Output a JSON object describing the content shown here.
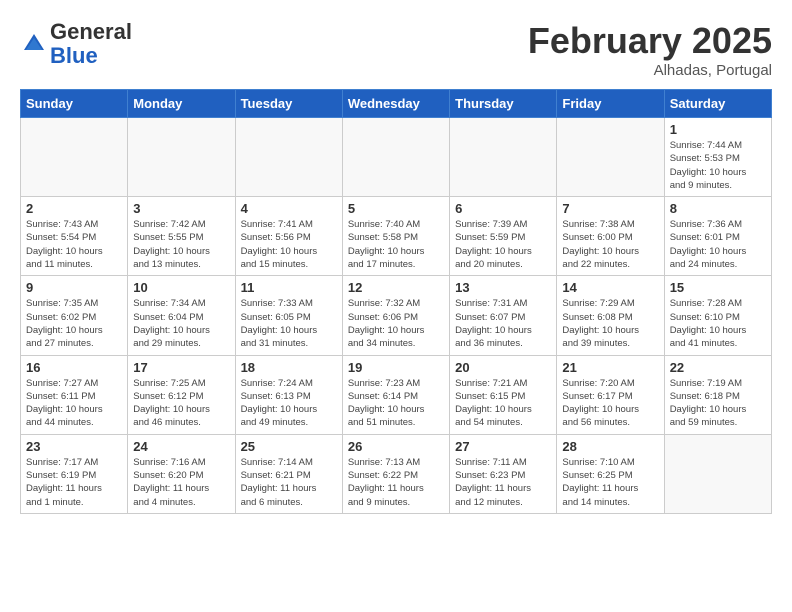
{
  "header": {
    "logo_general": "General",
    "logo_blue": "Blue",
    "month_year": "February 2025",
    "location": "Alhadas, Portugal"
  },
  "weekdays": [
    "Sunday",
    "Monday",
    "Tuesday",
    "Wednesday",
    "Thursday",
    "Friday",
    "Saturday"
  ],
  "weeks": [
    [
      {
        "day": "",
        "info": ""
      },
      {
        "day": "",
        "info": ""
      },
      {
        "day": "",
        "info": ""
      },
      {
        "day": "",
        "info": ""
      },
      {
        "day": "",
        "info": ""
      },
      {
        "day": "",
        "info": ""
      },
      {
        "day": "1",
        "info": "Sunrise: 7:44 AM\nSunset: 5:53 PM\nDaylight: 10 hours\nand 9 minutes."
      }
    ],
    [
      {
        "day": "2",
        "info": "Sunrise: 7:43 AM\nSunset: 5:54 PM\nDaylight: 10 hours\nand 11 minutes."
      },
      {
        "day": "3",
        "info": "Sunrise: 7:42 AM\nSunset: 5:55 PM\nDaylight: 10 hours\nand 13 minutes."
      },
      {
        "day": "4",
        "info": "Sunrise: 7:41 AM\nSunset: 5:56 PM\nDaylight: 10 hours\nand 15 minutes."
      },
      {
        "day": "5",
        "info": "Sunrise: 7:40 AM\nSunset: 5:58 PM\nDaylight: 10 hours\nand 17 minutes."
      },
      {
        "day": "6",
        "info": "Sunrise: 7:39 AM\nSunset: 5:59 PM\nDaylight: 10 hours\nand 20 minutes."
      },
      {
        "day": "7",
        "info": "Sunrise: 7:38 AM\nSunset: 6:00 PM\nDaylight: 10 hours\nand 22 minutes."
      },
      {
        "day": "8",
        "info": "Sunrise: 7:36 AM\nSunset: 6:01 PM\nDaylight: 10 hours\nand 24 minutes."
      }
    ],
    [
      {
        "day": "9",
        "info": "Sunrise: 7:35 AM\nSunset: 6:02 PM\nDaylight: 10 hours\nand 27 minutes."
      },
      {
        "day": "10",
        "info": "Sunrise: 7:34 AM\nSunset: 6:04 PM\nDaylight: 10 hours\nand 29 minutes."
      },
      {
        "day": "11",
        "info": "Sunrise: 7:33 AM\nSunset: 6:05 PM\nDaylight: 10 hours\nand 31 minutes."
      },
      {
        "day": "12",
        "info": "Sunrise: 7:32 AM\nSunset: 6:06 PM\nDaylight: 10 hours\nand 34 minutes."
      },
      {
        "day": "13",
        "info": "Sunrise: 7:31 AM\nSunset: 6:07 PM\nDaylight: 10 hours\nand 36 minutes."
      },
      {
        "day": "14",
        "info": "Sunrise: 7:29 AM\nSunset: 6:08 PM\nDaylight: 10 hours\nand 39 minutes."
      },
      {
        "day": "15",
        "info": "Sunrise: 7:28 AM\nSunset: 6:10 PM\nDaylight: 10 hours\nand 41 minutes."
      }
    ],
    [
      {
        "day": "16",
        "info": "Sunrise: 7:27 AM\nSunset: 6:11 PM\nDaylight: 10 hours\nand 44 minutes."
      },
      {
        "day": "17",
        "info": "Sunrise: 7:25 AM\nSunset: 6:12 PM\nDaylight: 10 hours\nand 46 minutes."
      },
      {
        "day": "18",
        "info": "Sunrise: 7:24 AM\nSunset: 6:13 PM\nDaylight: 10 hours\nand 49 minutes."
      },
      {
        "day": "19",
        "info": "Sunrise: 7:23 AM\nSunset: 6:14 PM\nDaylight: 10 hours\nand 51 minutes."
      },
      {
        "day": "20",
        "info": "Sunrise: 7:21 AM\nSunset: 6:15 PM\nDaylight: 10 hours\nand 54 minutes."
      },
      {
        "day": "21",
        "info": "Sunrise: 7:20 AM\nSunset: 6:17 PM\nDaylight: 10 hours\nand 56 minutes."
      },
      {
        "day": "22",
        "info": "Sunrise: 7:19 AM\nSunset: 6:18 PM\nDaylight: 10 hours\nand 59 minutes."
      }
    ],
    [
      {
        "day": "23",
        "info": "Sunrise: 7:17 AM\nSunset: 6:19 PM\nDaylight: 11 hours\nand 1 minute."
      },
      {
        "day": "24",
        "info": "Sunrise: 7:16 AM\nSunset: 6:20 PM\nDaylight: 11 hours\nand 4 minutes."
      },
      {
        "day": "25",
        "info": "Sunrise: 7:14 AM\nSunset: 6:21 PM\nDaylight: 11 hours\nand 6 minutes."
      },
      {
        "day": "26",
        "info": "Sunrise: 7:13 AM\nSunset: 6:22 PM\nDaylight: 11 hours\nand 9 minutes."
      },
      {
        "day": "27",
        "info": "Sunrise: 7:11 AM\nSunset: 6:23 PM\nDaylight: 11 hours\nand 12 minutes."
      },
      {
        "day": "28",
        "info": "Sunrise: 7:10 AM\nSunset: 6:25 PM\nDaylight: 11 hours\nand 14 minutes."
      },
      {
        "day": "",
        "info": ""
      }
    ]
  ]
}
